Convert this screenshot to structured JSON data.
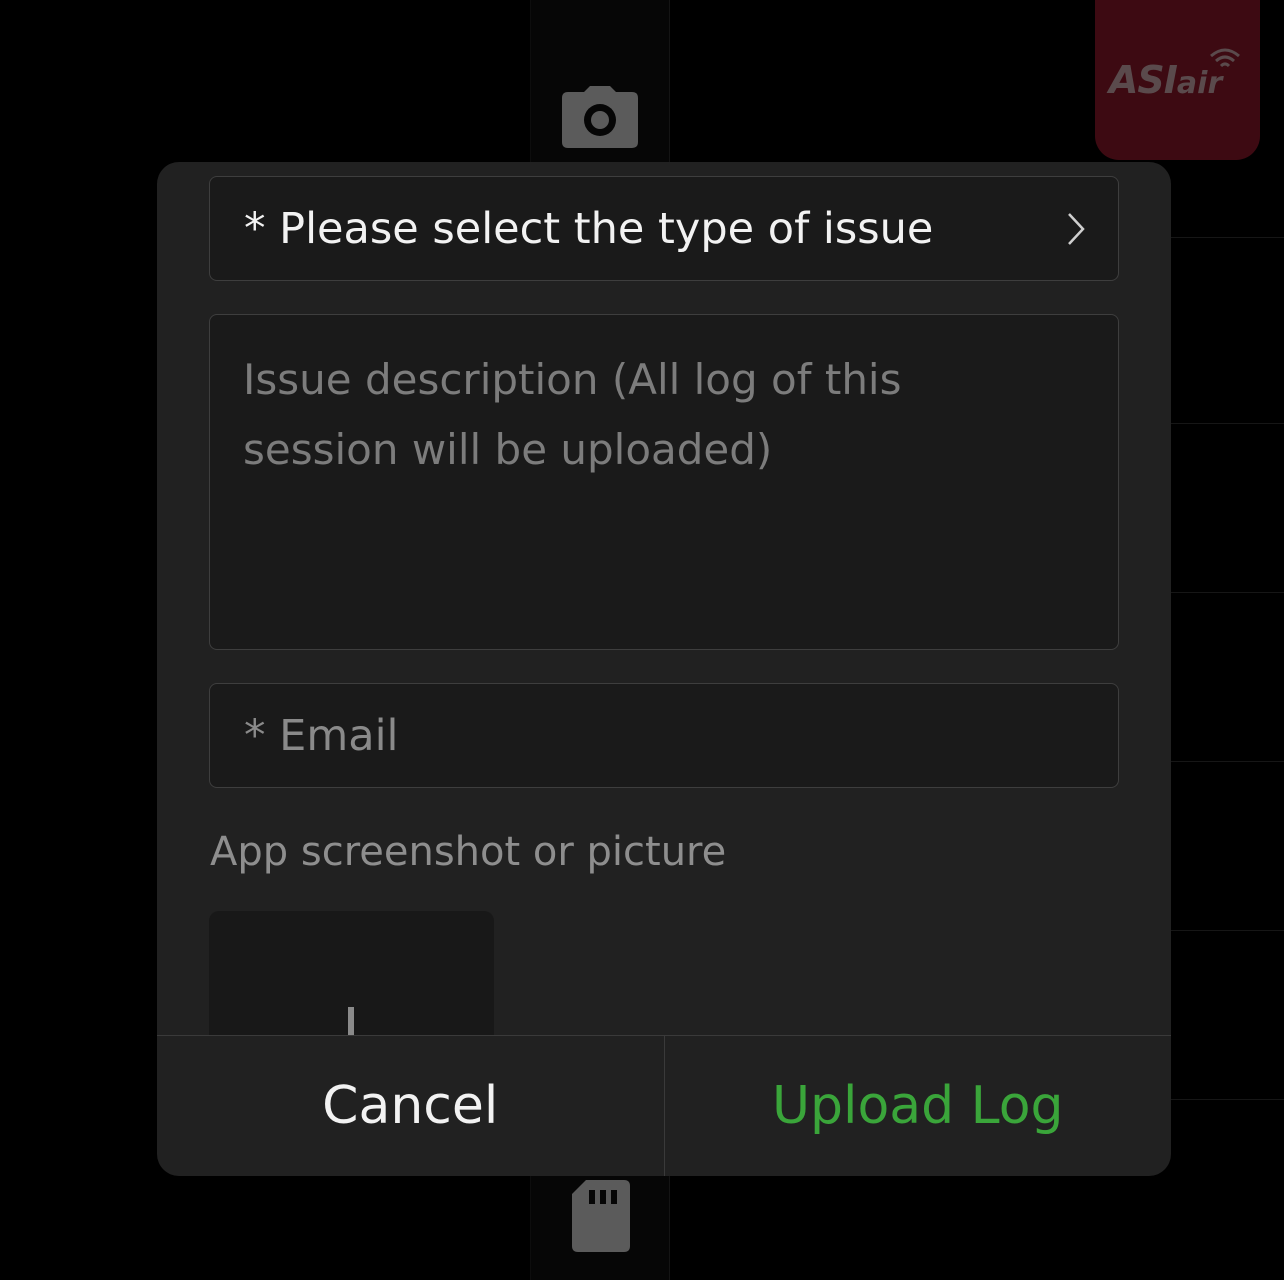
{
  "background": {
    "icons": [
      "camera-icon",
      "sd-card-icon"
    ]
  },
  "logo": {
    "text_main": "ASI",
    "text_suffix": "air",
    "color": "#3d0a12"
  },
  "dialog": {
    "issue_type": {
      "label": "* Please select the type of issue",
      "icon": "chevron-right-icon"
    },
    "description": {
      "placeholder": "Issue description (All log of this session will be uploaded)"
    },
    "email": {
      "placeholder": "* Email"
    },
    "picture_section_label": "App screenshot or picture",
    "add_picture_icon": "plus-icon",
    "buttons": {
      "cancel": "Cancel",
      "upload": "Upload Log"
    },
    "colors": {
      "accent": "#3aa53a",
      "background": "#212121"
    }
  }
}
